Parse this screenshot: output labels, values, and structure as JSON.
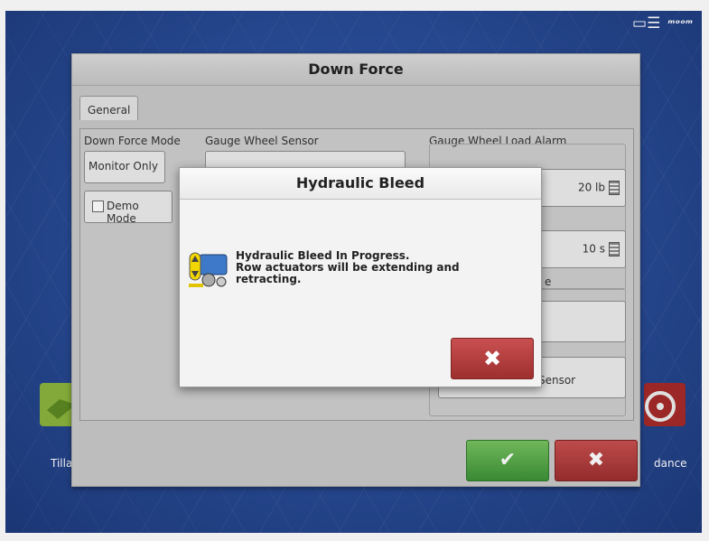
{
  "status_bar": {
    "display_icon": "monitor-icon",
    "signal_label": "ᵐᵒᵒᵐ"
  },
  "background_apps": {
    "left_label": "Tilla",
    "right_label": "dance"
  },
  "panel": {
    "title": "Down Force",
    "tab_general": "General",
    "down_force_mode_label": "Down Force Mode",
    "down_force_mode_value": "Monitor Only",
    "demo_mode_label": "Demo Mode",
    "gauge_wheel_sensor_label": "Gauge Wheel Sensor",
    "gauge_wheel_load_alarm_label": "Gauge Wheel Load Alarm",
    "load_value": "20 lb",
    "time_value": "10 s",
    "partial_label": "e",
    "sensor_button_partial": "sor",
    "calibrate_partial": "ate",
    "pressure_sensor_label": "Pressure Sensor",
    "ok_icon": "checkmark-icon",
    "cancel_icon": "close-icon"
  },
  "dialog": {
    "title": "Hydraulic Bleed",
    "message": "Hydraulic Bleed In Progress.\nRow actuators will be extending and\nretracting.",
    "icon": "planter-row-unit-icon",
    "close_icon": "close-icon"
  },
  "colors": {
    "confirm": "#4ea33f",
    "cancel": "#a83434",
    "screen": "#2b4f9c"
  }
}
